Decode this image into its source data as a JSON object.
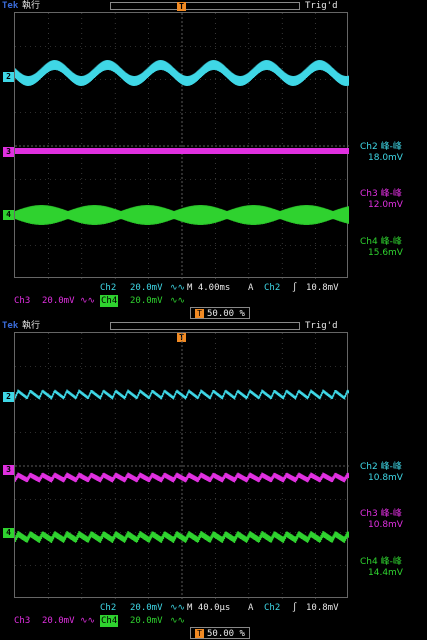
{
  "colors": {
    "ch2": "#3fd7e6",
    "ch3": "#e030e0",
    "ch4": "#2fd22f",
    "trigger": "#f08a24",
    "grid": "#5a5a5a",
    "tek": "#3a6bd8"
  },
  "screens": [
    {
      "top_bar": {
        "brand": "Tek",
        "state": "執行",
        "trig_status": "Trig'd"
      },
      "trigger_marker": "T",
      "channels": [
        "2",
        "3",
        "4"
      ],
      "measurements": [
        {
          "label": "Ch2 峰-峰",
          "value": "18.0mV"
        },
        {
          "label": "Ch3 峰-峰",
          "value": "12.0mV"
        },
        {
          "label": "Ch4 峰-峰",
          "value": "15.6mV"
        }
      ],
      "status_row1": {
        "ch2": "Ch2",
        "ch2_scale": "20.0mV",
        "bw": "∿∿",
        "timebase": "M 4.00ms",
        "mode": "A",
        "trig_src": "Ch2",
        "trig_slope": "∫",
        "trig_level": "10.8mV"
      },
      "status_row2": {
        "ch3": "Ch3",
        "ch3_scale": "20.0mV",
        "ch3_bw": "∿∿",
        "ch4": "Ch4",
        "ch4_scale": "20.0mV",
        "ch4_bw": "∿∿"
      }
    },
    {
      "top_bar": {
        "brand": "Tek",
        "state": "執行",
        "trig_status": "Trig'd"
      },
      "trigger_marker": "T",
      "trig_position": "50.00 %",
      "channels": [
        "2",
        "3",
        "4"
      ],
      "measurements": [
        {
          "label": "Ch2 峰-峰",
          "value": "10.8mV"
        },
        {
          "label": "Ch3 峰-峰",
          "value": "10.8mV"
        },
        {
          "label": "Ch4 峰-峰",
          "value": "14.4mV"
        }
      ],
      "status_row1": {
        "ch2": "Ch2",
        "ch2_scale": "20.0mV",
        "bw": "∿∿",
        "timebase": "M 40.0µs",
        "mode": "A",
        "trig_src": "Ch2",
        "trig_slope": "∫",
        "trig_level": "10.8mV"
      },
      "status_row2": {
        "ch3": "Ch3",
        "ch3_scale": "20.0mV",
        "ch3_bw": "∿∿",
        "ch4": "Ch4",
        "ch4_scale": "20.0mV",
        "ch4_bw": "∿∿"
      },
      "bottom_trig_position": "50.00 %"
    }
  ]
}
